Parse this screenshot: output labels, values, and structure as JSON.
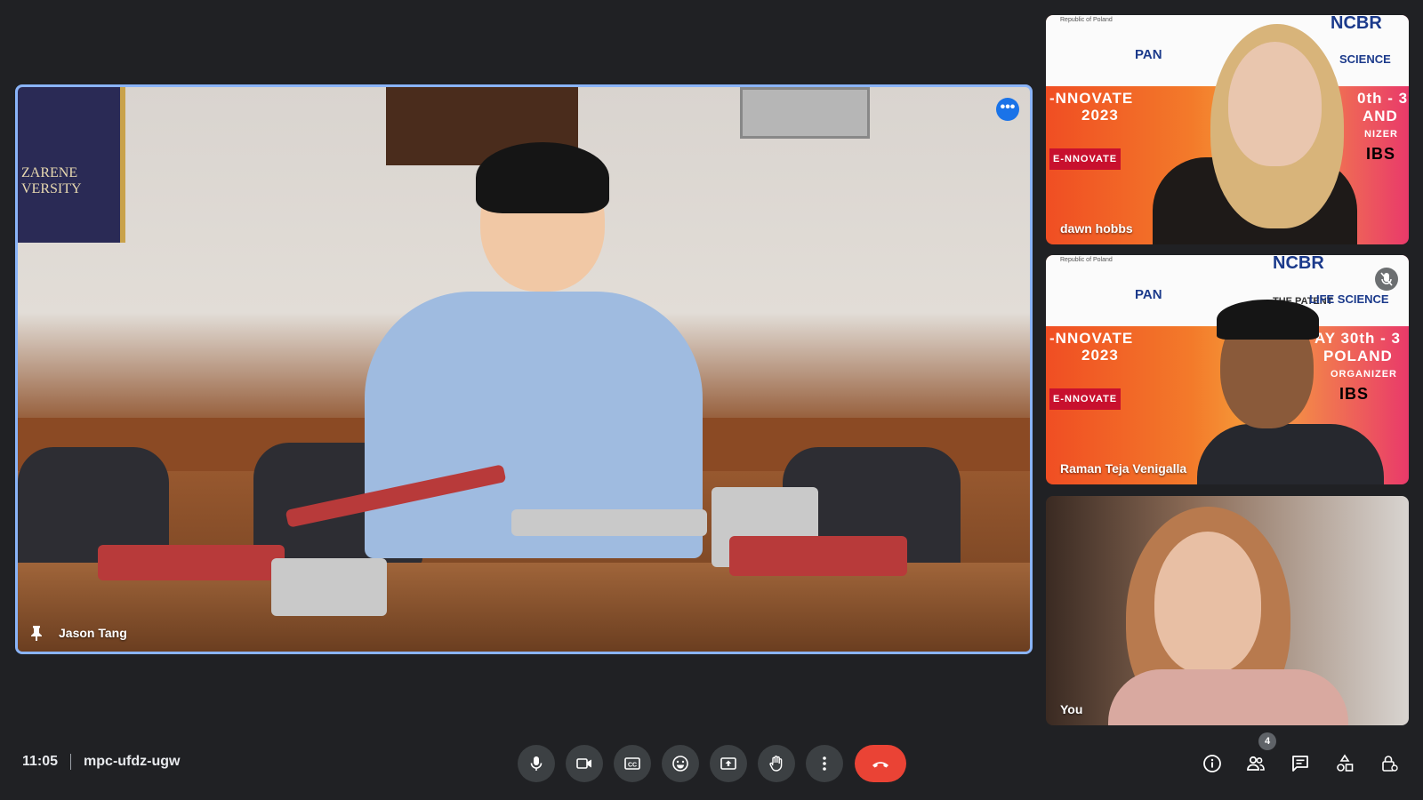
{
  "main_tile": {
    "participant_name": "Jason Tang",
    "banner_text": "ZARENE\nVERSITY"
  },
  "side_tiles": [
    {
      "participant_name": "dawn hobbs",
      "poster_line1": "-NNOVATE",
      "poster_line2": "2023",
      "poster_right1": "0th - 3",
      "poster_right2": "AND",
      "poster_right3": "NIZER",
      "poster_brand": "E-NNOVATE",
      "poster_top_logo": "NCBR",
      "poster_sponsor": "PAN",
      "poster_sci": "SCIENCE",
      "poster_country": "Republic of Poland",
      "poster_ibs": "IBS"
    },
    {
      "participant_name": "Raman Teja Venigalla",
      "poster_line1": "-NNOVATE",
      "poster_line2": "2023",
      "poster_right1": "AY 30th - 3",
      "poster_right2": "POLAND",
      "poster_right3": "ORGANIZER",
      "poster_brand": "E-NNOVATE",
      "poster_top_logo": "NCBR",
      "poster_sponsor": "PAN",
      "poster_sci": "LIFE SCIENCE",
      "poster_country": "Republic of Poland",
      "poster_ibs": "IBS",
      "poster_patent": "THE PATENT",
      "muted": true
    },
    {
      "participant_name": "You"
    }
  ],
  "meeting": {
    "time": "11:05",
    "code": "mpc-ufdz-ugw"
  },
  "controls": {
    "center": [
      "microphone-icon",
      "camera-icon",
      "captions-icon",
      "emoji-icon",
      "present-icon",
      "raise-hand-icon",
      "more-options-icon"
    ],
    "end_call": "end-call-icon",
    "right": [
      "info-icon",
      "people-icon",
      "chat-icon",
      "activities-icon",
      "host-controls-icon"
    ],
    "people_count": "4"
  },
  "colors": {
    "background": "#202124",
    "active_speaker_border": "#8ab4f8",
    "end_call": "#ea4335",
    "button_bg": "#3c4043"
  }
}
